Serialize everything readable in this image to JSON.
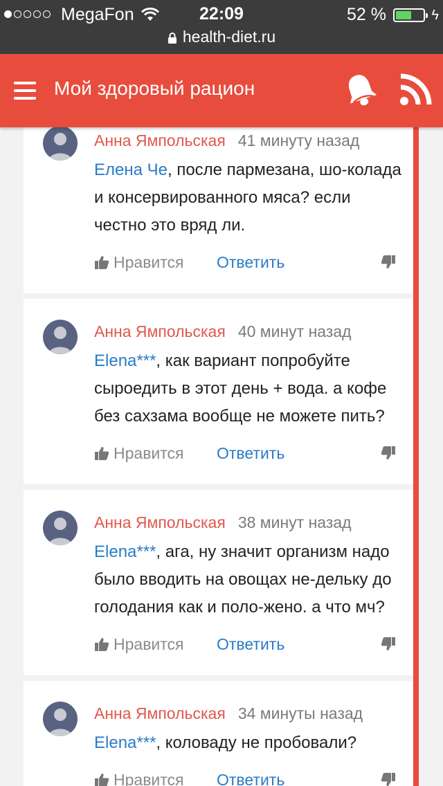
{
  "status_bar": {
    "carrier": "MegaFon",
    "time": "22:09",
    "battery_percent": "52 %",
    "battery_level": 0.52,
    "url": "health-diet.ru"
  },
  "app_bar": {
    "title": "Мой здоровый рацион"
  },
  "comments": [
    {
      "author": "Анна Ямпольская",
      "time": "41 минуту назад",
      "mention": "Елена Че",
      "text": ", после пармезана, шо-колада и консервированного мяса? если честно это вряд ли.",
      "like_label": "Нравится",
      "reply_label": "Ответить"
    },
    {
      "author": "Анна Ямпольская",
      "time": "40 минут назад",
      "mention": "Elena***",
      "text": ", как вариант попробуйте сыроедить в этот день + вода. а кофе без сахзама вообще не можете пить?",
      "like_label": "Нравится",
      "reply_label": "Ответить"
    },
    {
      "author": "Анна Ямпольская",
      "time": "38 минут назад",
      "mention": "Elena***",
      "text": ", ага, ну значит организм надо было вводить на овощах не-дельку до голодания как и поло-жено. а что мч?",
      "like_label": "Нравится",
      "reply_label": "Ответить"
    },
    {
      "author": "Анна Ямпольская",
      "time": "34 минуты назад",
      "mention": "Elena***",
      "text": ", коловаду не пробовали?",
      "like_label": "Нравится",
      "reply_label": "Ответить"
    }
  ],
  "colors": {
    "accent": "#e84c3d",
    "author": "#e0584c",
    "link": "#2a7bc6",
    "status_bar": "#3c3c3c"
  }
}
